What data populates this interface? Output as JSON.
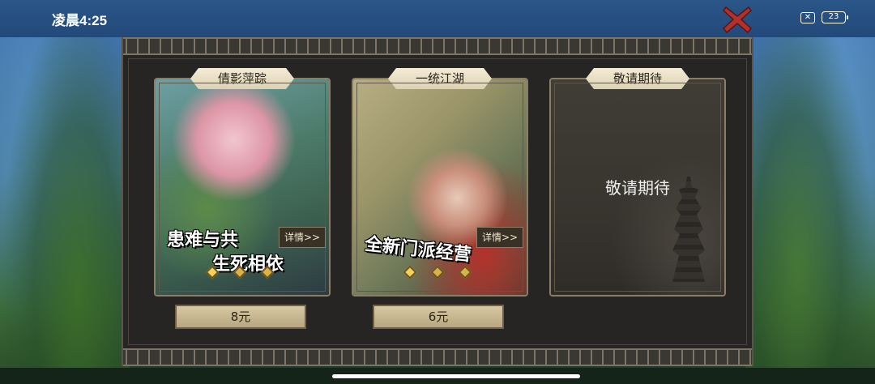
{
  "status_bar": {
    "time": "凌晨4:25",
    "battery": "23"
  },
  "cards": [
    {
      "title": "倩影萍踪",
      "slogan_line1": "患难与共",
      "slogan_line2": "生死相依",
      "detail_label": "详情>>",
      "price": "8元"
    },
    {
      "title": "一统江湖",
      "slogan_line1": "全新门派经营",
      "detail_label": "详情>>",
      "price": "6元"
    },
    {
      "title": "敬请期待",
      "body_text": "敬请期待"
    }
  ],
  "colors": {
    "panel_bg": "#262523",
    "title_badge": "#f3ecd6",
    "price_button": "#d7c8a4",
    "close_x": "#b2312c"
  },
  "icons": {
    "close": "close-x-icon",
    "sim": "no-sim-icon",
    "battery": "battery-icon"
  }
}
